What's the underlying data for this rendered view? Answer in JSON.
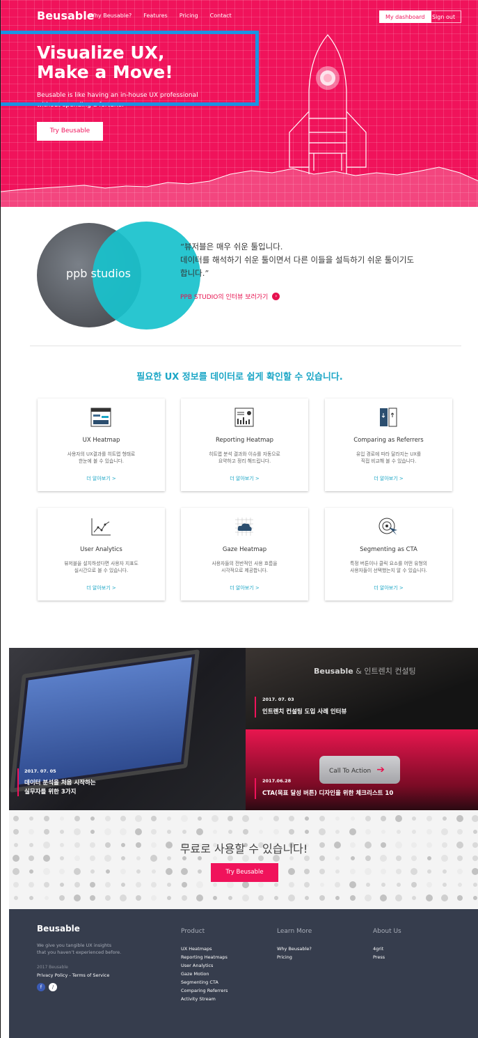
{
  "nav": {
    "logo": "Beusable",
    "links": [
      "Why Beusable?",
      "Features",
      "Pricing",
      "Contact"
    ],
    "dashboard": "My dashboard",
    "signout": "Sign out"
  },
  "hero": {
    "title_line1": "Visualize UX,",
    "title_line2": "Make a Move!",
    "sub_line1": "Beusable is like having an in-house UX professional",
    "sub_line2": "without spending a fortune.",
    "cta": "Try Beusable"
  },
  "testimonial": {
    "brand": "ppb studios",
    "quote_line1": "“뷰저블은 매우 쉬운 툴입니다.",
    "quote_line2": "데이터를 해석하기 쉬운 툴이면서 다른 이들을 설득하기 쉬운 툴이기도",
    "quote_line3": "합니다.”",
    "link": "PPB STUDIO의 인터뷰 보러가기"
  },
  "features": {
    "title": "필요한 UX 정보를 데이터로 쉽게 확인할 수 있습니다.",
    "more": "더 알아보기 >",
    "cards": [
      {
        "title": "UX Heatmap",
        "desc1": "사용자의 UX결과를 히트맵 형태로",
        "desc2": "한눈에 볼 수 있습니다.",
        "icon": "heatmap-icon"
      },
      {
        "title": "Reporting Heatmap",
        "desc1": "히트맵 분석 결과와 이슈를 자동으로",
        "desc2": "요약하고 정리 해드립니다.",
        "icon": "report-icon"
      },
      {
        "title": "Comparing as Referrers",
        "desc1": "유입 경로에 따라 달라지는 UX를",
        "desc2": "직접 비교해 볼 수 있습니다.",
        "icon": "compare-icon"
      },
      {
        "title": "User Analytics",
        "desc1": "뷰저블을 설치하셨다면 사용자 지표도",
        "desc2": "실시간으로 볼 수 있습니다.",
        "icon": "line-chart-icon"
      },
      {
        "title": "Gaze Heatmap",
        "desc1": "사용자들의 전반적인 사용 흐름을",
        "desc2": "시각적으로 제공합니다.",
        "icon": "cloud-icon"
      },
      {
        "title": "Segmenting as CTA",
        "desc1": "특정 버튼이나 클릭 요소를 어떤 유형의",
        "desc2": "사용자들이 선택했는지 알 수 있습니다.",
        "icon": "target-icon"
      }
    ]
  },
  "blog": {
    "post1_date": "2017. 07. 05",
    "post1_line1": "데이터 분석을 처음 시작하는",
    "post1_line2": "실무자를 위한 3가지",
    "post2_date": "2017. 07. 03",
    "post2_title": "인트렌치 컨설팅 도입 사례 인터뷰",
    "post2_tag_brand": "Beusable",
    "post2_tag_rest": " & 인트렌치 컨설팅",
    "post3_date": "2017.06.28",
    "post3_title": "CTA(목표 달성 버튼) 디자인을 위한 체크리스트 10",
    "post3_button": "Call To Action"
  },
  "free": {
    "title": "무료로 사용할 수 있습니다!",
    "cta": "Try Beusable"
  },
  "footer": {
    "logo": "Beusable",
    "tagline1": "We give you tangible UX insights",
    "tagline2": "that you haven’t experienced before.",
    "year": "2017 Beusable",
    "policy": "Privacy Policy - Terms of Service",
    "product_h": "Product",
    "product": [
      "UX Heatmaps",
      "Reporting Heatmaps",
      "User Analytics",
      "Gaze Motion",
      "Segmenting CTA",
      "Comparing Referrers",
      "Activity Stream"
    ],
    "learn_h": "Learn More",
    "learn": [
      "Why Beusable?",
      "Pricing"
    ],
    "about_h": "About Us",
    "about": [
      "4grit",
      "Press"
    ]
  },
  "colors": {
    "brand": "#f0135b",
    "accent": "#1ba6c6",
    "footer": "#363d4d",
    "highlight": "#1a93e3"
  }
}
